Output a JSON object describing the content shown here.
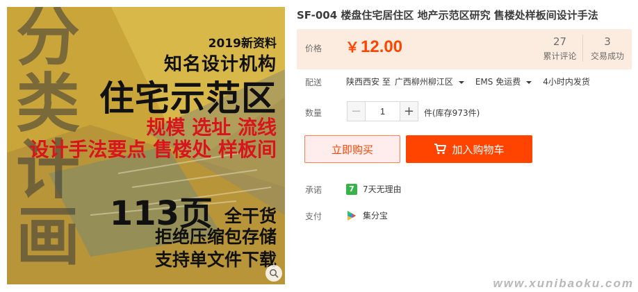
{
  "product_image": {
    "vertical_text": [
      "分",
      "类",
      "计",
      "画"
    ],
    "year_tag": "2019新资料",
    "org": "知名设计机构",
    "headline": "住宅示范区",
    "red_line_1": "规模 选址 流线",
    "red_line_2": "设计手法要点 售楼处 样板间",
    "pages": "113页",
    "dry_goods": "全干货",
    "line_1": "拒绝压缩包存储",
    "line_2": "支持单文件下载",
    "zoom_icon": "magnifier-icon"
  },
  "product": {
    "title": "SF-004 楼盘住宅居住区 地产示范区研究 售楼处样板间设计手法"
  },
  "price": {
    "label": "价格",
    "currency": "￥",
    "amount": "12.00",
    "reviews_count": "27",
    "reviews_label": "累计评论",
    "trades_count": "3",
    "trades_label": "交易成功"
  },
  "shipping": {
    "label": "配送",
    "from": "陕西西安 至",
    "to": "广西柳州柳江区",
    "method": "EMS 免运费",
    "dispatch": "4小时内发货"
  },
  "quantity": {
    "label": "数量",
    "minus": "−",
    "value": "1",
    "plus": "+",
    "stock": "件(库存973件)"
  },
  "actions": {
    "buy_now": "立即购买",
    "add_to_cart": "加入购物车"
  },
  "promise": {
    "label": "承诺",
    "icon_text": "7",
    "text": "7天无理由"
  },
  "payment": {
    "label": "支付",
    "text": "集分宝"
  },
  "watermark": "www.xunibaoku.com",
  "colors": {
    "accent": "#ff4400",
    "price_bg": "#fcecdf",
    "promise_green": "#37b34a"
  }
}
